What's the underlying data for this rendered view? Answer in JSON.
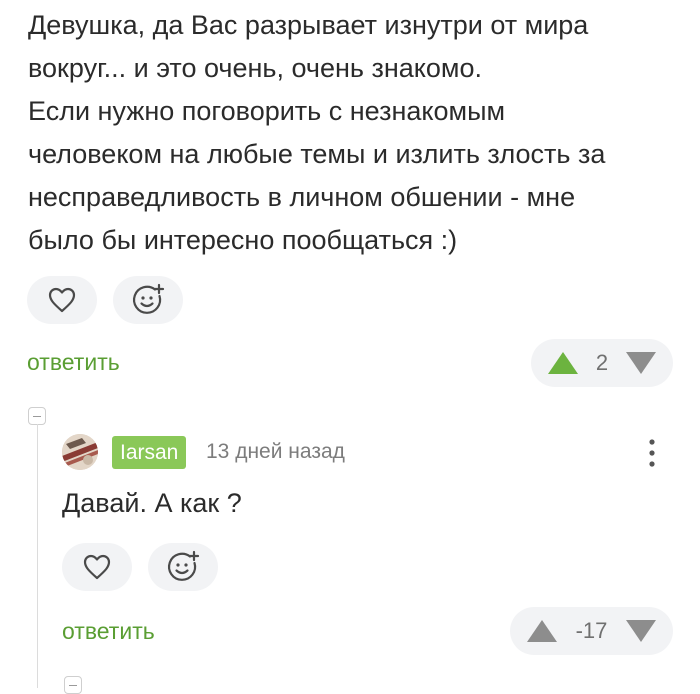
{
  "comment": {
    "lines": [
      "Девушка, да Вас разрывает изнутри от мира",
      "вокруг... и это очень, очень знакомо.",
      "Если нужно поговорить с незнакомым",
      "человеком на любые темы и излить злость за",
      "несправедливость в личном обшении - мне",
      "было бы интересно пообщаться :)"
    ],
    "reply_label": "ответить",
    "rating": "2",
    "upvote_color": "#6cb33f",
    "downvote_color": "#8d8d8d"
  },
  "reply": {
    "username": "Iarsan",
    "timestamp": "13 дней назад",
    "text": "Давай. А как ?",
    "reply_label": "ответить",
    "rating": "-17",
    "username_bg": "#8ac858"
  },
  "icons": {
    "like": "heart-icon",
    "react": "smiley-add-icon",
    "more": "vertical-dots-icon",
    "up": "triangle-up-icon",
    "down": "triangle-down-icon",
    "collapse": "collapse-minus-icon"
  }
}
